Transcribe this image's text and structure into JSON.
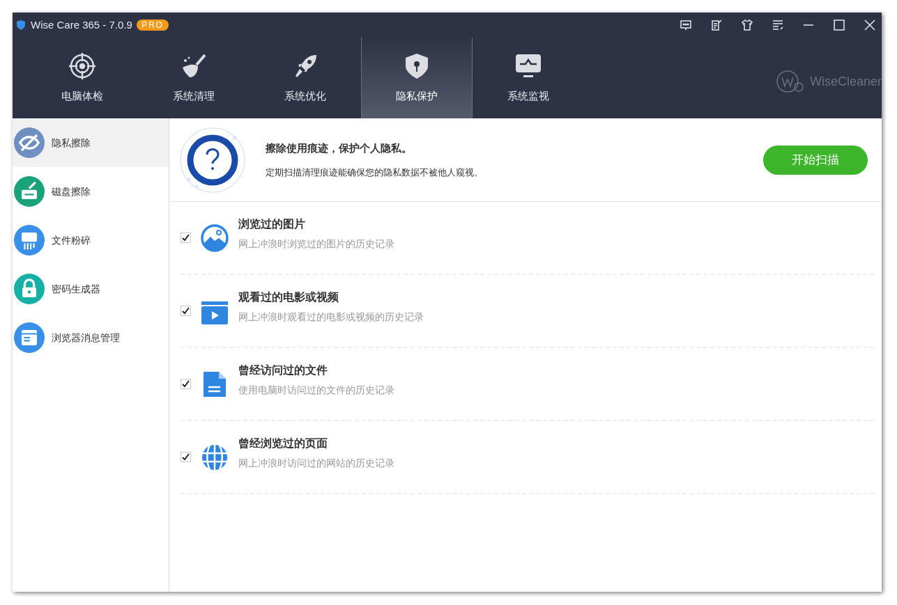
{
  "window": {
    "title": "Wise Care 365 - 7.0.9",
    "badge": "PRO"
  },
  "tabs": [
    {
      "label": "电脑体检",
      "selected": false
    },
    {
      "label": "系统清理",
      "selected": false
    },
    {
      "label": "系统优化",
      "selected": false
    },
    {
      "label": "隐私保护",
      "selected": true
    },
    {
      "label": "系统监视",
      "selected": false
    }
  ],
  "brand": "WiseCleaner",
  "sidebar": {
    "items": [
      {
        "label": "隐私擦除",
        "selected": true
      },
      {
        "label": "磁盘擦除",
        "selected": false
      },
      {
        "label": "文件粉碎",
        "selected": false
      },
      {
        "label": "密码生成器",
        "selected": false
      },
      {
        "label": "浏览器消息管理",
        "selected": false
      }
    ]
  },
  "banner": {
    "title": "擦除使用痕迹，保护个人隐私。",
    "subtitle": "定期扫描清理痕迹能确保您的隐私数据不被他人窥视。",
    "button": "开始扫描"
  },
  "items": [
    {
      "title": "浏览过的图片",
      "description": "网上冲浪时浏览过的图片的历史记录",
      "checked": true
    },
    {
      "title": "观看过的电影或视频",
      "description": "网上冲浪时观看过的电影或视频的历史记录",
      "checked": true
    },
    {
      "title": "曾经访问过的文件",
      "description": "使用电脑时访问过的文件的历史记录",
      "checked": true
    },
    {
      "title": "曾经浏览过的页面",
      "description": "网上冲浪时访问过的网站的历史记录",
      "checked": true
    }
  ]
}
